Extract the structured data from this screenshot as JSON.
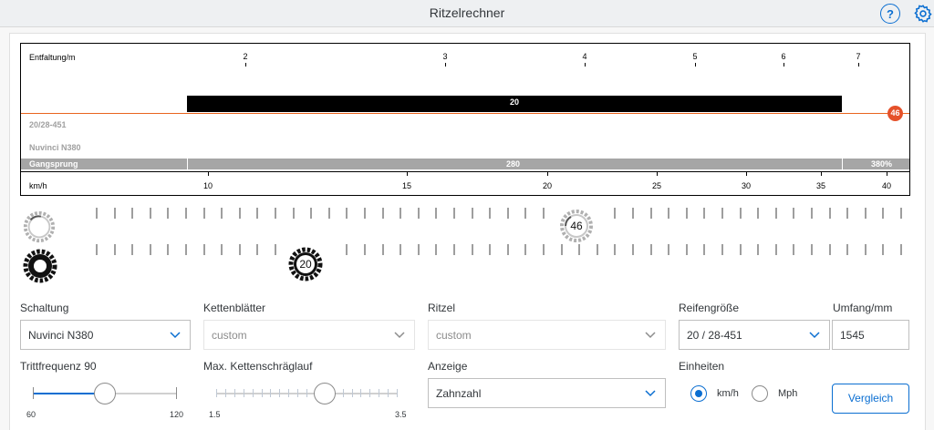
{
  "app": {
    "title": "Ritzelrechner"
  },
  "header": {
    "help_label": "?",
    "icons": [
      "help-icon",
      "gear-icon"
    ]
  },
  "chart_top": {
    "label": "Entfaltung/m",
    "ticks": [
      "2",
      "3",
      "4",
      "5",
      "6",
      "7"
    ]
  },
  "chart_rows": {
    "bar_value": "20",
    "badge_value": "46",
    "row1_label": "20/28-451",
    "row2_label": "Nuvinci N380",
    "gangsprung_label": "Gangsprung",
    "gangsprung_value": "280",
    "gangsprung_total": "380%"
  },
  "chart_bottom": {
    "label": "km/h",
    "ticks": [
      "10",
      "15",
      "20",
      "25",
      "30",
      "35",
      "40"
    ]
  },
  "gears": {
    "chainring_value": "46",
    "cog_value": "20"
  },
  "form": {
    "schaltung": {
      "label": "Schaltung",
      "value": "Nuvinci N380"
    },
    "kettenblaetter": {
      "label": "Kettenblätter",
      "value": "custom"
    },
    "ritzel": {
      "label": "Ritzel",
      "value": "custom"
    },
    "reifengroesse": {
      "label": "Reifengröße",
      "value": "20 / 28-451"
    },
    "umfang": {
      "label": "Umfang/mm",
      "value": "1545"
    },
    "trittfrequenz": {
      "label": "Trittfrequenz 90",
      "min": "60",
      "max": "120",
      "value": 90
    },
    "kettenschraeglauf": {
      "label": "Max. Kettenschräglauf",
      "min": "1.5",
      "max": "3.5",
      "value": 2.7
    },
    "anzeige": {
      "label": "Anzeige",
      "value": "Zahnzahl"
    },
    "einheiten": {
      "label": "Einheiten",
      "options": [
        "km/h",
        "Mph"
      ],
      "selected": "km/h"
    },
    "vergleich_label": "Vergleich"
  },
  "colors": {
    "accent": "#0a6ed1",
    "badge": "#e5512a",
    "redline": "#e9651f"
  }
}
